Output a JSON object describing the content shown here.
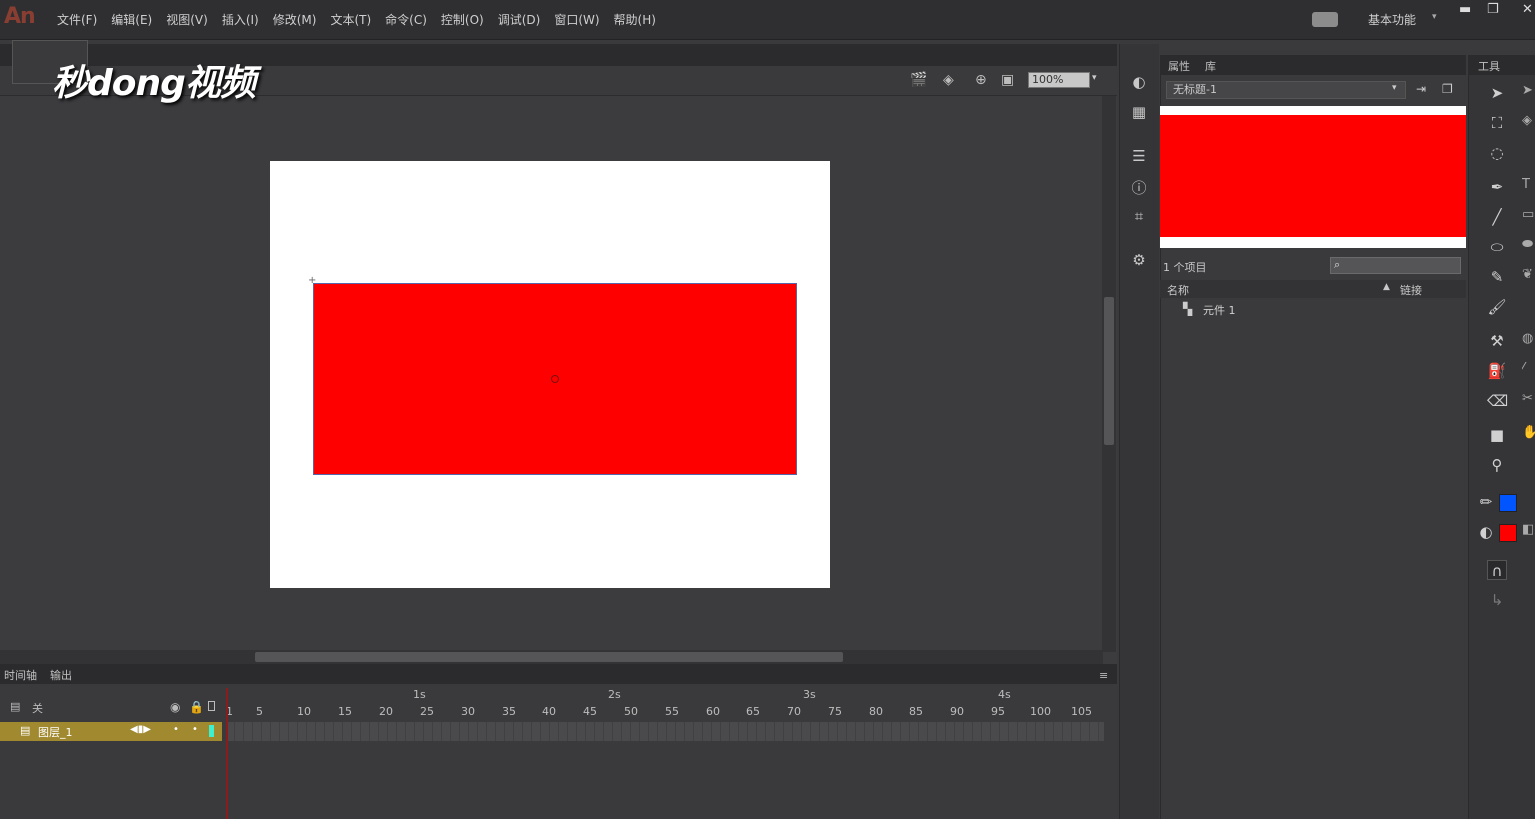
{
  "app": {
    "logo": "An"
  },
  "menu": [
    "文件(F)",
    "编辑(E)",
    "视图(V)",
    "插入(I)",
    "修改(M)",
    "文本(T)",
    "命令(C)",
    "控制(O)",
    "调试(D)",
    "窗口(W)",
    "帮助(H)"
  ],
  "workspace": {
    "label": "基本功能"
  },
  "editbar": {
    "zoom": "100%"
  },
  "watermark": {
    "text": "秒dong视频"
  },
  "timeline": {
    "tabs": [
      "时间轴",
      "输出"
    ],
    "layer_name": "图层_1",
    "header_label": "关",
    "seconds": [
      "1s",
      "2s",
      "3s",
      "4s"
    ],
    "frames": [
      "1",
      "5",
      "10",
      "15",
      "20",
      "25",
      "30",
      "35",
      "40",
      "45",
      "50",
      "55",
      "60",
      "65",
      "70",
      "75",
      "80",
      "85",
      "90",
      "95",
      "100",
      "105"
    ]
  },
  "library": {
    "tabs": [
      "属性",
      "库"
    ],
    "document": "无标题-1",
    "item_count": "1 个项目",
    "col_name": "名称",
    "col_link": "链接",
    "item": "元件 1"
  },
  "tools": {
    "title": "工具"
  },
  "colors": {
    "stage": "#ffffff",
    "shape_fill": "#ff0000",
    "stroke": "#0055ff",
    "fill": "#ff0000"
  }
}
